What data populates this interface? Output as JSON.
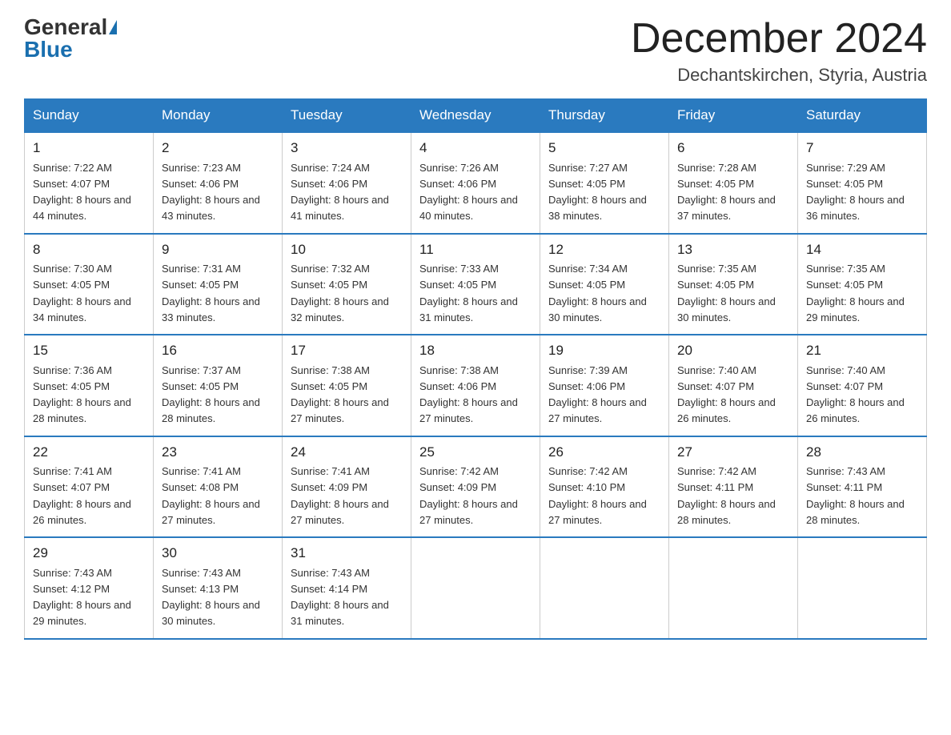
{
  "header": {
    "logo_general": "General",
    "logo_blue": "Blue",
    "month_title": "December 2024",
    "location": "Dechantskirchen, Styria, Austria"
  },
  "weekdays": [
    "Sunday",
    "Monday",
    "Tuesday",
    "Wednesday",
    "Thursday",
    "Friday",
    "Saturday"
  ],
  "weeks": [
    [
      {
        "day": "1",
        "sunrise": "7:22 AM",
        "sunset": "4:07 PM",
        "daylight": "8 hours and 44 minutes."
      },
      {
        "day": "2",
        "sunrise": "7:23 AM",
        "sunset": "4:06 PM",
        "daylight": "8 hours and 43 minutes."
      },
      {
        "day": "3",
        "sunrise": "7:24 AM",
        "sunset": "4:06 PM",
        "daylight": "8 hours and 41 minutes."
      },
      {
        "day": "4",
        "sunrise": "7:26 AM",
        "sunset": "4:06 PM",
        "daylight": "8 hours and 40 minutes."
      },
      {
        "day": "5",
        "sunrise": "7:27 AM",
        "sunset": "4:05 PM",
        "daylight": "8 hours and 38 minutes."
      },
      {
        "day": "6",
        "sunrise": "7:28 AM",
        "sunset": "4:05 PM",
        "daylight": "8 hours and 37 minutes."
      },
      {
        "day": "7",
        "sunrise": "7:29 AM",
        "sunset": "4:05 PM",
        "daylight": "8 hours and 36 minutes."
      }
    ],
    [
      {
        "day": "8",
        "sunrise": "7:30 AM",
        "sunset": "4:05 PM",
        "daylight": "8 hours and 34 minutes."
      },
      {
        "day": "9",
        "sunrise": "7:31 AM",
        "sunset": "4:05 PM",
        "daylight": "8 hours and 33 minutes."
      },
      {
        "day": "10",
        "sunrise": "7:32 AM",
        "sunset": "4:05 PM",
        "daylight": "8 hours and 32 minutes."
      },
      {
        "day": "11",
        "sunrise": "7:33 AM",
        "sunset": "4:05 PM",
        "daylight": "8 hours and 31 minutes."
      },
      {
        "day": "12",
        "sunrise": "7:34 AM",
        "sunset": "4:05 PM",
        "daylight": "8 hours and 30 minutes."
      },
      {
        "day": "13",
        "sunrise": "7:35 AM",
        "sunset": "4:05 PM",
        "daylight": "8 hours and 30 minutes."
      },
      {
        "day": "14",
        "sunrise": "7:35 AM",
        "sunset": "4:05 PM",
        "daylight": "8 hours and 29 minutes."
      }
    ],
    [
      {
        "day": "15",
        "sunrise": "7:36 AM",
        "sunset": "4:05 PM",
        "daylight": "8 hours and 28 minutes."
      },
      {
        "day": "16",
        "sunrise": "7:37 AM",
        "sunset": "4:05 PM",
        "daylight": "8 hours and 28 minutes."
      },
      {
        "day": "17",
        "sunrise": "7:38 AM",
        "sunset": "4:05 PM",
        "daylight": "8 hours and 27 minutes."
      },
      {
        "day": "18",
        "sunrise": "7:38 AM",
        "sunset": "4:06 PM",
        "daylight": "8 hours and 27 minutes."
      },
      {
        "day": "19",
        "sunrise": "7:39 AM",
        "sunset": "4:06 PM",
        "daylight": "8 hours and 27 minutes."
      },
      {
        "day": "20",
        "sunrise": "7:40 AM",
        "sunset": "4:07 PM",
        "daylight": "8 hours and 26 minutes."
      },
      {
        "day": "21",
        "sunrise": "7:40 AM",
        "sunset": "4:07 PM",
        "daylight": "8 hours and 26 minutes."
      }
    ],
    [
      {
        "day": "22",
        "sunrise": "7:41 AM",
        "sunset": "4:07 PM",
        "daylight": "8 hours and 26 minutes."
      },
      {
        "day": "23",
        "sunrise": "7:41 AM",
        "sunset": "4:08 PM",
        "daylight": "8 hours and 27 minutes."
      },
      {
        "day": "24",
        "sunrise": "7:41 AM",
        "sunset": "4:09 PM",
        "daylight": "8 hours and 27 minutes."
      },
      {
        "day": "25",
        "sunrise": "7:42 AM",
        "sunset": "4:09 PM",
        "daylight": "8 hours and 27 minutes."
      },
      {
        "day": "26",
        "sunrise": "7:42 AM",
        "sunset": "4:10 PM",
        "daylight": "8 hours and 27 minutes."
      },
      {
        "day": "27",
        "sunrise": "7:42 AM",
        "sunset": "4:11 PM",
        "daylight": "8 hours and 28 minutes."
      },
      {
        "day": "28",
        "sunrise": "7:43 AM",
        "sunset": "4:11 PM",
        "daylight": "8 hours and 28 minutes."
      }
    ],
    [
      {
        "day": "29",
        "sunrise": "7:43 AM",
        "sunset": "4:12 PM",
        "daylight": "8 hours and 29 minutes."
      },
      {
        "day": "30",
        "sunrise": "7:43 AM",
        "sunset": "4:13 PM",
        "daylight": "8 hours and 30 minutes."
      },
      {
        "day": "31",
        "sunrise": "7:43 AM",
        "sunset": "4:14 PM",
        "daylight": "8 hours and 31 minutes."
      },
      null,
      null,
      null,
      null
    ]
  ]
}
